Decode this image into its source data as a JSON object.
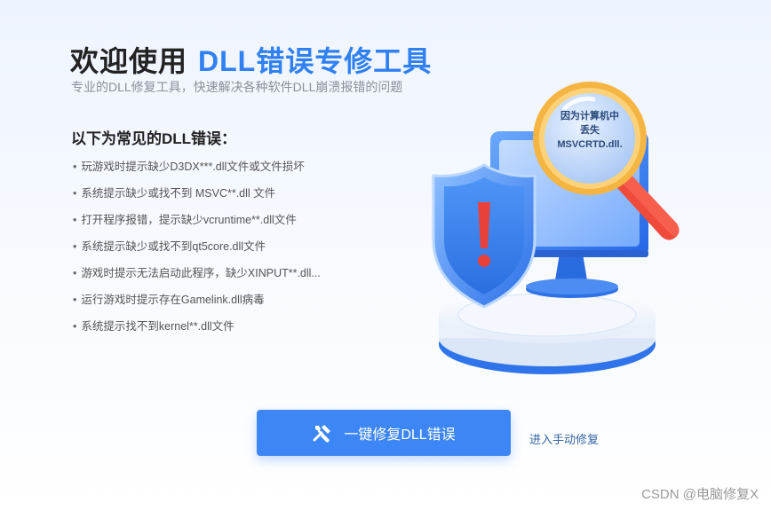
{
  "header": {
    "title_prefix": "欢迎使用",
    "title_highlight": "DLL错误专修工具",
    "subtitle": "专业的DLL修复工具，快速解决各种软件DLL崩溃报错的问题"
  },
  "errors": {
    "heading": "以下为常见的DLL错误：",
    "items": [
      "玩游戏时提示缺少D3DX***.dll文件或文件损坏",
      "系统提示缺少或找不到 MSVC**.dll 文件",
      "打开程序报错，提示缺少vcruntime**.dll文件",
      "系统提示缺少或找不到qt5core.dll文件",
      "游戏时提示无法启动此程序，缺少XINPUT**.dll...",
      "运行游戏时提示存在Gamelink.dll病毒",
      "系统提示找不到kernel**.dll文件"
    ]
  },
  "illustration": {
    "lens_line1": "因为计算机中",
    "lens_line2": "丢失",
    "lens_line3": "MSVCRTD.dll."
  },
  "actions": {
    "repair_label": "一键修复DLL错误",
    "repair_icon": "tools-icon",
    "manual_label": "进入手动修复"
  },
  "watermark": "CSDN @电脑修复X",
  "colors": {
    "accent": "#2f80f2",
    "button": "#3d86f5",
    "link": "#3464a8"
  }
}
